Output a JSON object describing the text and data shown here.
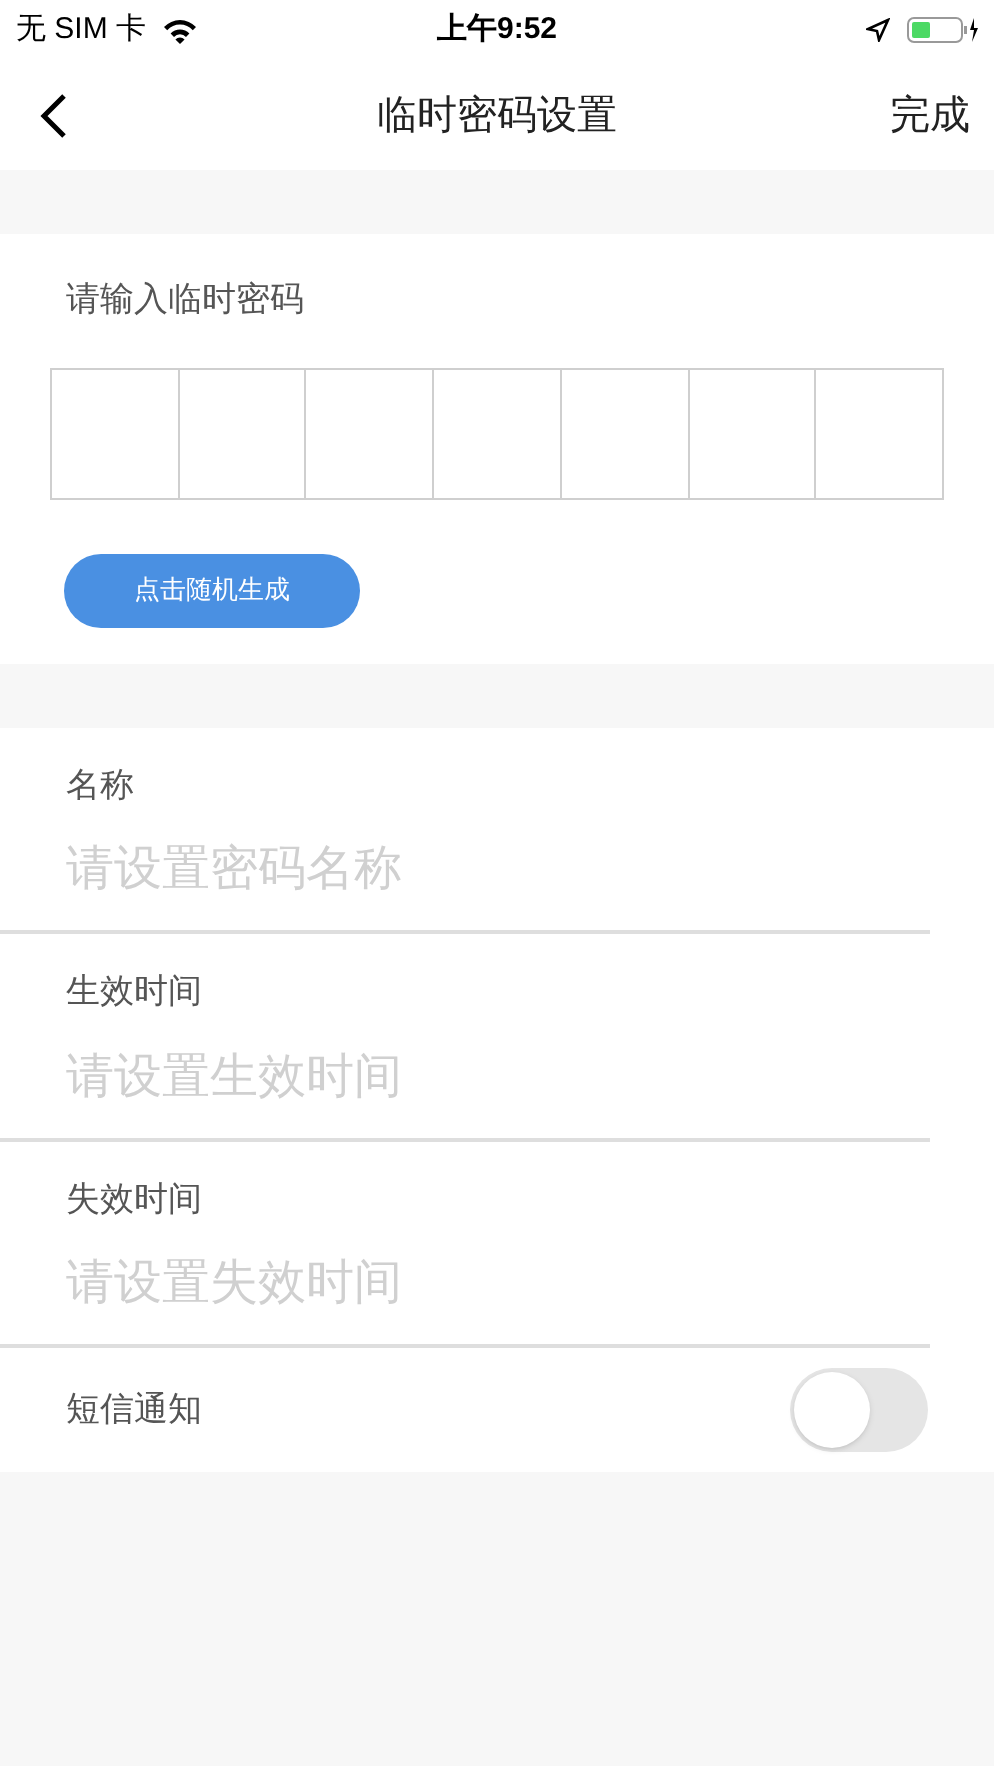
{
  "status_bar": {
    "carrier": "无 SIM 卡",
    "time": "上午9:52"
  },
  "nav": {
    "title": "临时密码设置",
    "action": "完成"
  },
  "password": {
    "label": "请输入临时密码",
    "generate_button": "点击随机生成"
  },
  "fields": [
    {
      "label": "名称",
      "placeholder": "请设置密码名称"
    },
    {
      "label": "生效时间",
      "placeholder": "请设置生效时间"
    },
    {
      "label": "失效时间",
      "placeholder": "请设置失效时间"
    }
  ],
  "sms": {
    "label": "短信通知",
    "on": false
  }
}
